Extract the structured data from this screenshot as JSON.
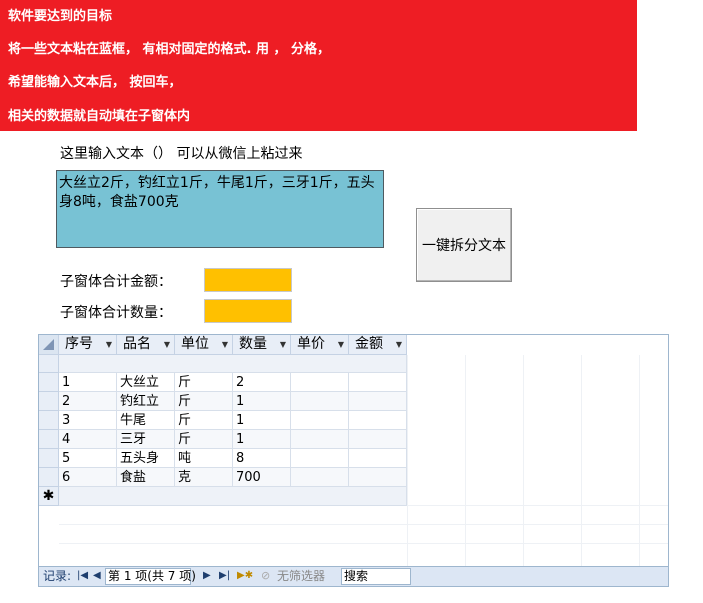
{
  "banner": {
    "lines": [
      "软件要达到的目标",
      "将一些文本粘在蓝框， 有相对固定的格式.  用 ，  分格，",
      "希望能输入文本后， 按回车，",
      "相关的数据就自动填在子窗体内"
    ]
  },
  "input_section": {
    "label": "这里输入文本（）  可以从微信上粘过来",
    "text": "大丝立2斤，钓红立1斤，牛尾1斤，三牙1斤，五头身8吨，食盐700克",
    "split_button": "一键拆分文本"
  },
  "totals": {
    "amount_label": "子窗体合计金额：",
    "amount_value": "",
    "quantity_label": "子窗体合计数量：",
    "quantity_value": ""
  },
  "grid": {
    "headers": [
      "序号",
      "品名",
      "单位",
      "数量",
      "单价",
      "金额"
    ],
    "rows": [
      [
        "1",
        "大丝立",
        "斤",
        "2",
        "",
        ""
      ],
      [
        "2",
        "钓红立",
        "斤",
        "1",
        "",
        ""
      ],
      [
        "3",
        "牛尾",
        "斤",
        "1",
        "",
        ""
      ],
      [
        "4",
        "三牙",
        "斤",
        "1",
        "",
        ""
      ],
      [
        "5",
        "五头身",
        "吨",
        "8",
        "",
        ""
      ],
      [
        "6",
        "食盐",
        "克",
        "700",
        "",
        ""
      ]
    ],
    "new_row_marker": "✱"
  },
  "navigator": {
    "record_label": "记录:",
    "position": "第 1 项(共 7 项)",
    "filter_label": "无筛选器",
    "search_label": "搜索"
  },
  "colors": {
    "banner": "#ee1d24",
    "textbox": "#78c2d4",
    "totals_box": "#ffc000"
  }
}
